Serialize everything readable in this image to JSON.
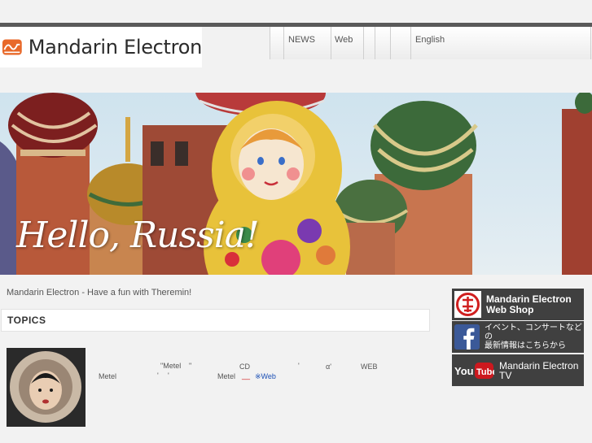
{
  "site": {
    "logo_text": "Mandarin Electron",
    "tagline": "Mandarin Electron - Have a fun with Theremin!",
    "hero_caption": "Hello, Russia!"
  },
  "nav": {
    "items": [
      {
        "label": ""
      },
      {
        "label": "NEWS"
      },
      {
        "label": "Web"
      },
      {
        "label": ""
      },
      {
        "label": ""
      },
      {
        "label": ""
      },
      {
        "label": "English"
      }
    ]
  },
  "topics": {
    "header": "TOPICS",
    "line1": [
      "\"Metel",
      "\"",
      "CD",
      "'",
      "α'",
      "WEB"
    ],
    "line2": [
      "Metel",
      "'",
      "'",
      "Metel",
      "__",
      "※Web"
    ]
  },
  "banners": [
    {
      "line1": "Mandarin Electron",
      "line2": "Web Shop"
    },
    {
      "line1": "イベント、コンサートなどの",
      "line2": "最新情報はこちらから"
    },
    {
      "line1": "Mandarin Electron",
      "line2": "TV",
      "icon_label": "You Tube"
    }
  ],
  "colors": {
    "logo_orange": "#e8692a",
    "nav_border": "#cfcfcf",
    "banner_bg": "#404040",
    "facebook_blue": "#3b5998",
    "youtube_red": "#cc181e",
    "link_blue": "#1b4fb5"
  },
  "icons": {
    "logo": "wave-logo-icon",
    "shop": "shop-seal-icon",
    "facebook": "facebook-icon",
    "youtube": "youtube-icon"
  }
}
